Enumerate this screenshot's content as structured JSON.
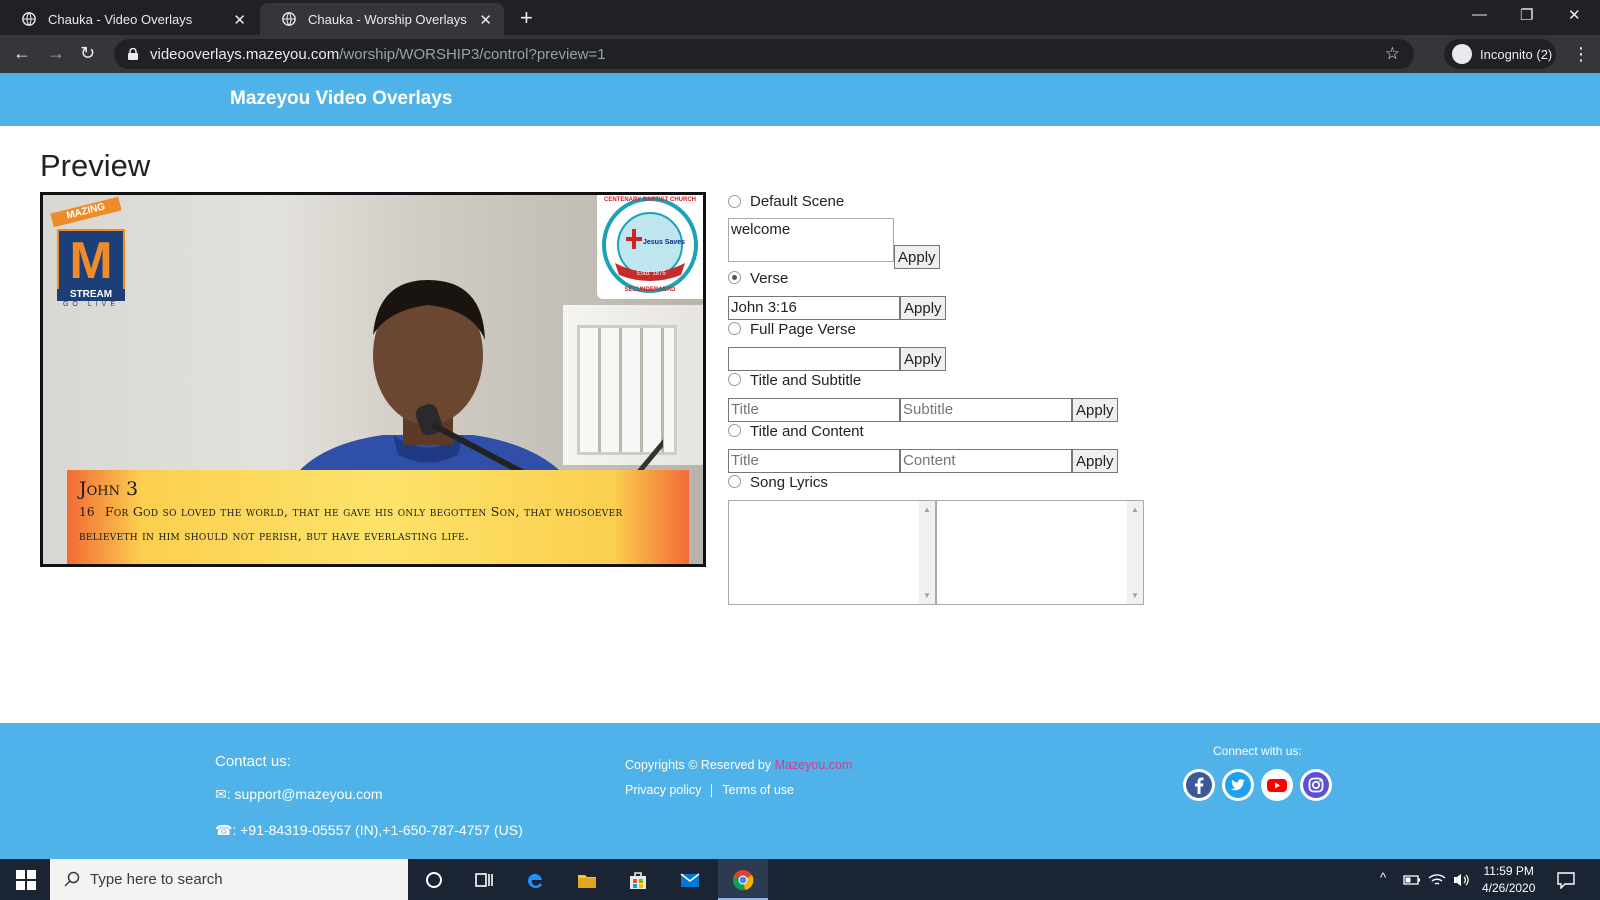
{
  "browser": {
    "tabs": [
      {
        "title": "Chauka - Video Overlays",
        "active": false
      },
      {
        "title": "Chauka - Worship Overlays",
        "active": true
      }
    ],
    "url_host": "videooverlays.mazeyou.com",
    "url_path": "/worship/WORSHIP3/control?preview=1",
    "incognito_label": "Incognito (2)"
  },
  "header": {
    "brand": "Mazeyou Video Overlays"
  },
  "preview": {
    "title": "Preview",
    "overlay": {
      "reference": "John 3",
      "verse_number": "16",
      "verse_text": "For God so loved the world, that he gave his only begotten Son, that whosoever believeth in him should not perish, but have everlasting life.",
      "stream_logo_top": "MAZING",
      "stream_logo_letter": "M",
      "stream_logo_word": "STREAM",
      "stream_logo_tag": "GO LIVE",
      "church_name": "CENTENARY BAPTIST CHURCH",
      "church_city": "SECUNDERABAD",
      "church_motto": "Jesus Saves",
      "church_estd": "Estd. 1875"
    }
  },
  "controls": {
    "apply_label": "Apply",
    "default_scene": {
      "label": "Default Scene",
      "value": "welcome",
      "selected": false
    },
    "verse": {
      "label": "Verse",
      "value": "John 3:16",
      "selected": true
    },
    "full_page_verse": {
      "label": "Full Page Verse",
      "value": "",
      "selected": false
    },
    "title_subtitle": {
      "label": "Title and Subtitle",
      "title_placeholder": "Title",
      "subtitle_placeholder": "Subtitle",
      "selected": false
    },
    "title_content": {
      "label": "Title and Content",
      "title_placeholder": "Title",
      "content_placeholder": "Content",
      "selected": false
    },
    "song_lyrics": {
      "label": "Song Lyrics",
      "selected": false
    }
  },
  "footer": {
    "contact_heading": "Contact us:",
    "email": ": support@mazeyou.com",
    "phone": ": +91-84319-05557 (IN),+1-650-787-4757 (US)",
    "copyright_prefix": "Copyrights © Reserved by ",
    "copyright_brand": "Mazeyou.com",
    "privacy": "Privacy policy",
    "terms": "Terms of use",
    "connect": "Connect with us:",
    "social_icons": [
      "facebook-icon",
      "twitter-icon",
      "youtube-icon",
      "instagram-icon"
    ]
  },
  "taskbar": {
    "search_placeholder": "Type here to search",
    "time": "11:59 PM",
    "date": "4/26/2020"
  },
  "colors": {
    "accent_blue": "#4fb2e8",
    "banner_yellow": "#fde36a",
    "banner_orange": "#f26b35",
    "brand_link": "#e0388c"
  }
}
